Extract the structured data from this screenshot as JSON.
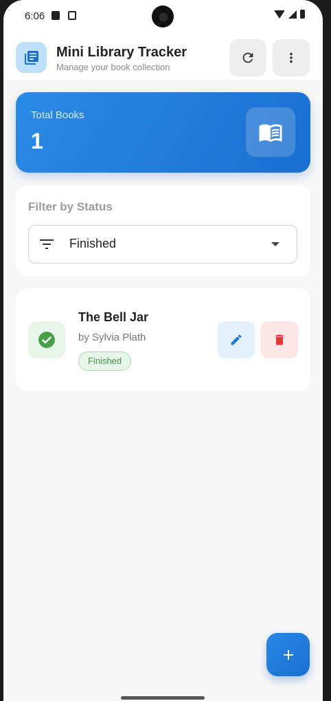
{
  "status_bar": {
    "time": "6:06"
  },
  "app_bar": {
    "title": "Mini Library Tracker",
    "subtitle": "Manage your book collection"
  },
  "stats": {
    "label": "Total Books",
    "value": "1"
  },
  "filter": {
    "title": "Filter by Status",
    "selected": "Finished"
  },
  "books": [
    {
      "title": "The Bell Jar",
      "author": "by Sylvia Plath",
      "status": "Finished"
    }
  ],
  "colors": {
    "primary": "#1f7ad8",
    "finished_green": "#43a047",
    "delete_red": "#e53935"
  },
  "icons": {
    "logo": "library-books-icon",
    "refresh": "refresh-icon",
    "more": "more-vert-icon",
    "stats": "menu-book-icon",
    "filter": "filter-list-icon",
    "status": "check-circle-icon",
    "edit": "edit-icon",
    "delete": "delete-icon",
    "fab": "add-icon"
  }
}
